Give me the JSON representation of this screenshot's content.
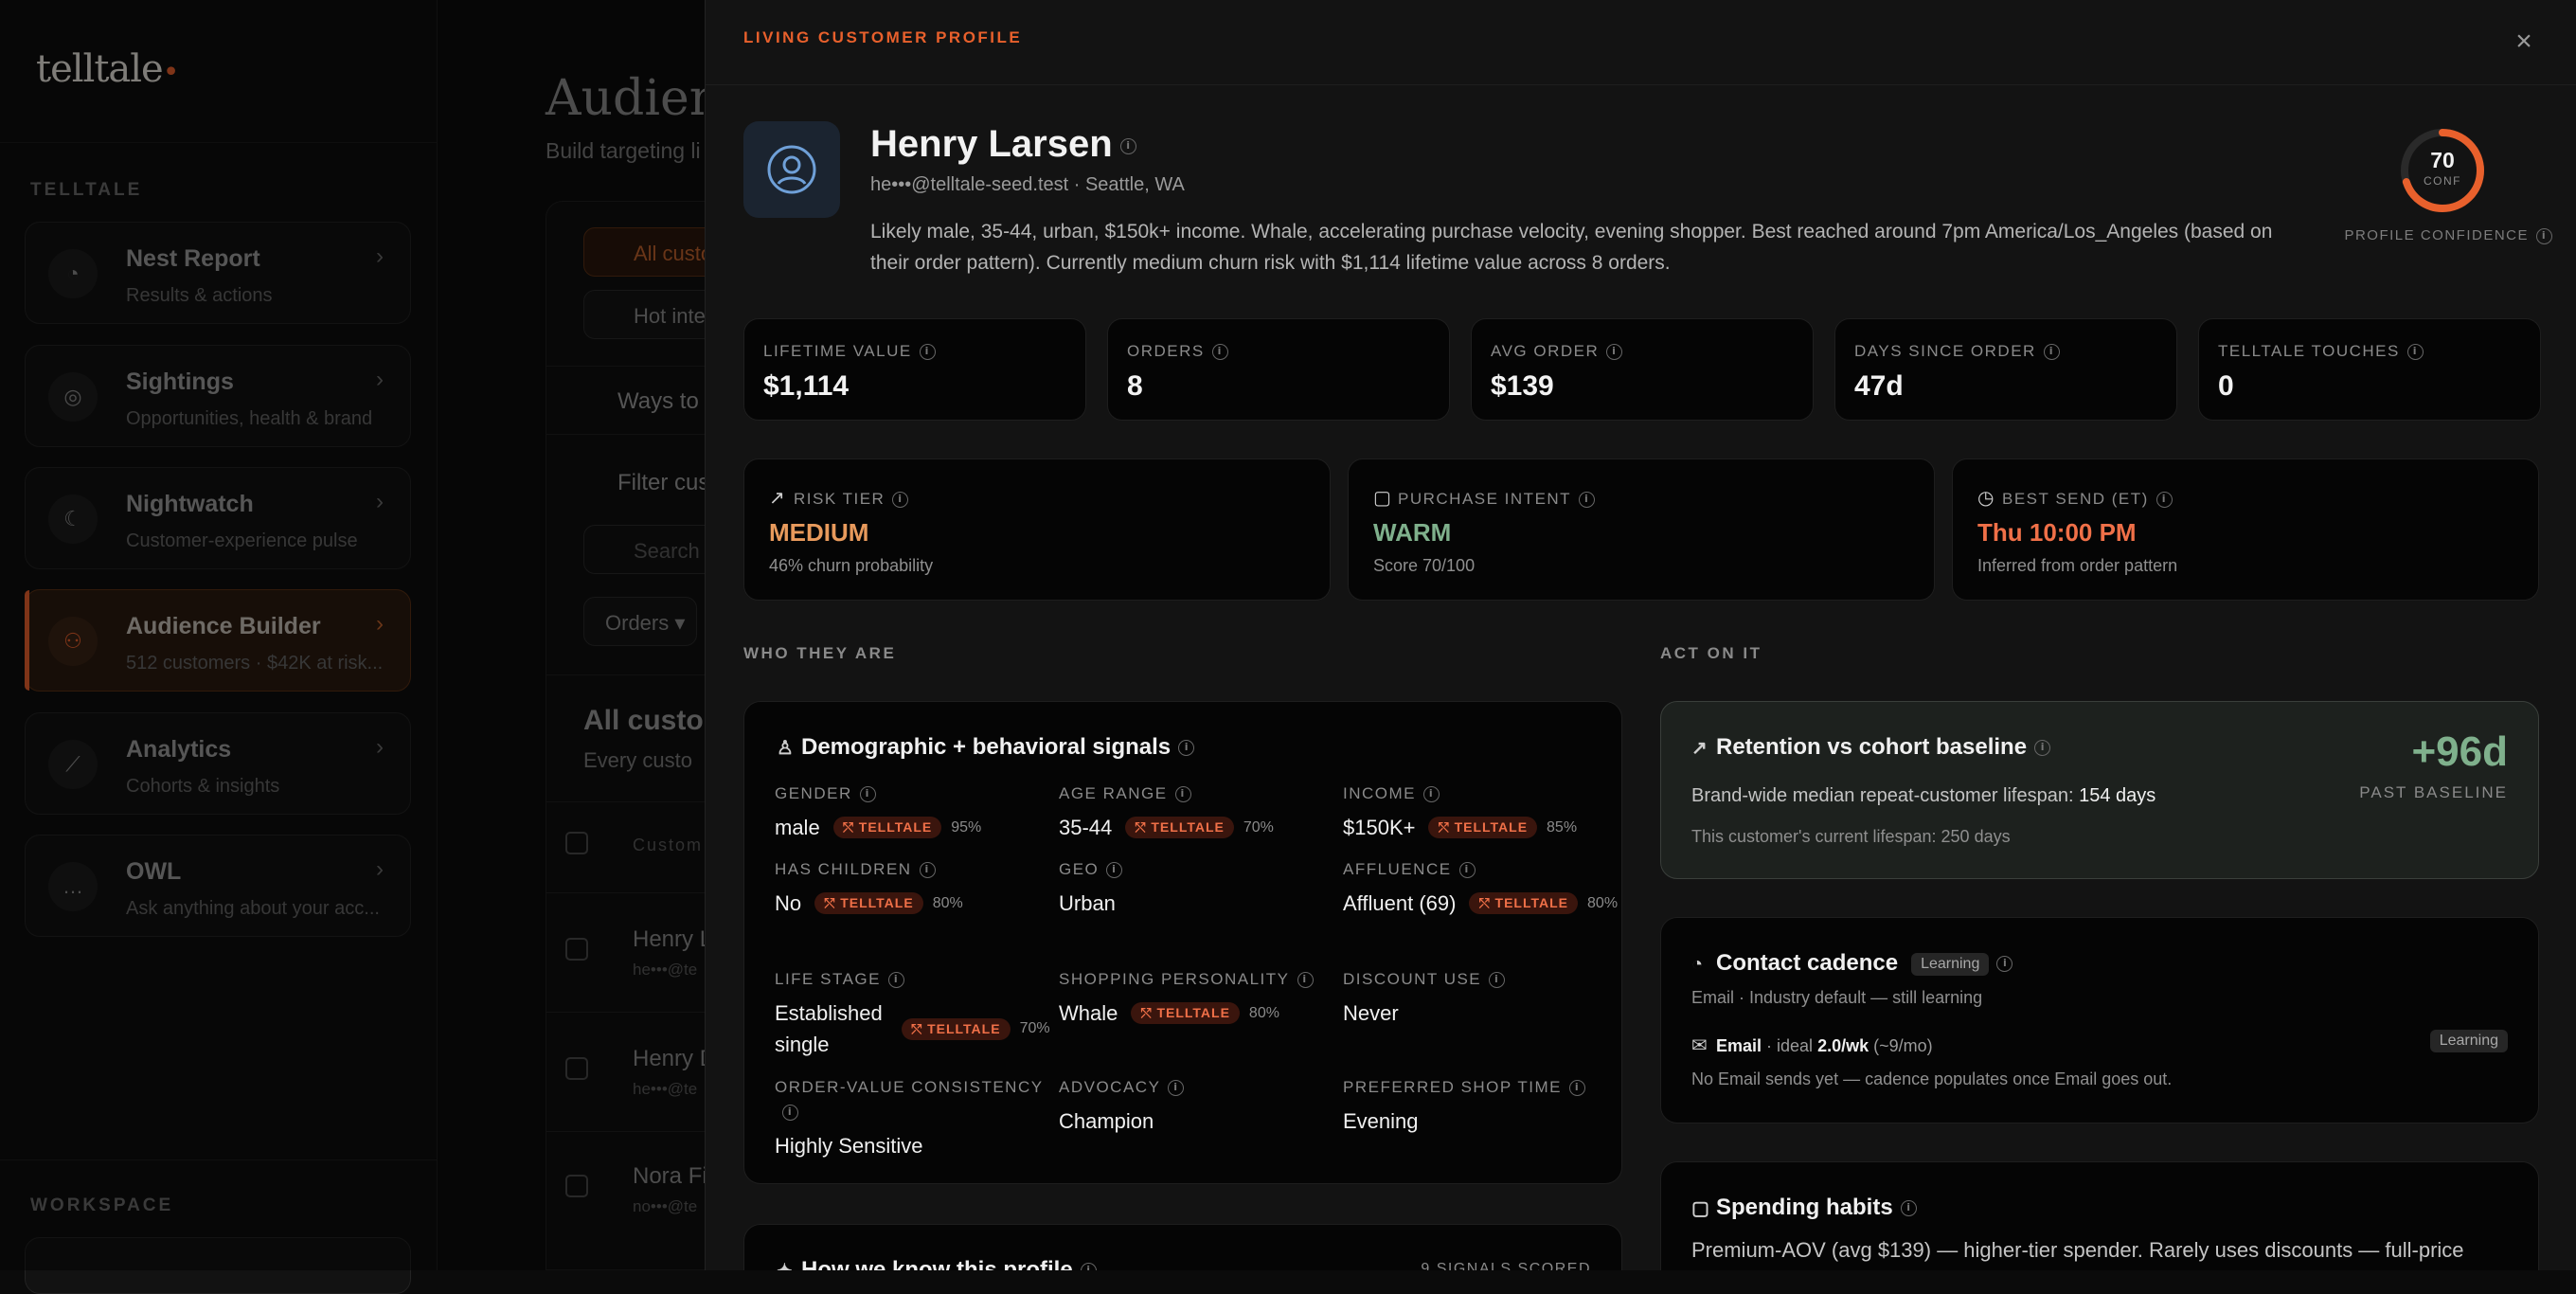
{
  "sidebar": {
    "logo": "telltale",
    "section_label": "TELLTALE",
    "workspace_label": "WORKSPACE",
    "items": [
      {
        "title": "Nest Report",
        "subtitle": "Results & actions"
      },
      {
        "title": "Sightings",
        "subtitle": "Opportunities, health & brand"
      },
      {
        "title": "Nightwatch",
        "subtitle": "Customer-experience pulse"
      },
      {
        "title": "Audience Builder",
        "subtitle": "512 customers · $42K at risk..."
      },
      {
        "title": "Analytics",
        "subtitle": "Cohorts & insights"
      },
      {
        "title": "OWL",
        "subtitle": "Ask anything about your acc..."
      }
    ]
  },
  "background": {
    "title": "Audien",
    "subtitle": "Build targeting li",
    "chip_all": "All custo",
    "chip_hot": "Hot inte",
    "ways": "Ways to",
    "filter": "Filter cus",
    "search_placeholder": "Search",
    "orders_select": "Orders",
    "list_title": "All custon",
    "list_sub": "Every custo",
    "col_header": "Custom",
    "rows": [
      {
        "name": "Henry L",
        "email": "he•••@te"
      },
      {
        "name": "Henry D",
        "email": "he•••@te"
      },
      {
        "name": "Nora Fi",
        "email": "no•••@te"
      }
    ]
  },
  "drawer": {
    "kicker": "LIVING CUSTOMER PROFILE",
    "close_label": "×",
    "profile": {
      "name": "Henry Larsen",
      "email": "he•••@telltale-seed.test · Seattle, WA",
      "summary": "Likely male, 35-44, urban, $150k+ income. Whale, accelerating purchase velocity, evening shopper. Best reached around 7pm America/Los_Angeles (based on their order pattern). Currently medium churn risk with $1,114 lifetime value across 8 orders.",
      "confidence": 70,
      "confidence_unit": "CONF",
      "confidence_label": "PROFILE CONFIDENCE"
    },
    "stats": [
      {
        "label": "LIFETIME VALUE",
        "value": "$1,114"
      },
      {
        "label": "ORDERS",
        "value": "8"
      },
      {
        "label": "AVG ORDER",
        "value": "$139"
      },
      {
        "label": "DAYS SINCE ORDER",
        "value": "47d"
      },
      {
        "label": "TELLTALE TOUCHES",
        "value": "0"
      }
    ],
    "signals": [
      {
        "label": "RISK TIER",
        "value": "MEDIUM",
        "sub": "46% churn probability",
        "color": "#e89a5c"
      },
      {
        "label": "PURCHASE INTENT",
        "value": "WARM",
        "sub": "Score 70/100",
        "color": "#7fb08c"
      },
      {
        "label": "BEST SEND (ET)",
        "value": "Thu 10:00 PM",
        "sub": "Inferred from order pattern",
        "color": "#f07048"
      }
    ],
    "who_label": "WHO THEY ARE",
    "act_label": "ACT ON IT",
    "demo": {
      "title": "Demographic + behavioral signals",
      "badge": "TELLTALE",
      "attributes": [
        {
          "label": "GENDER",
          "value": "male",
          "pct": "95%"
        },
        {
          "label": "AGE RANGE",
          "value": "35-44",
          "pct": "70%"
        },
        {
          "label": "INCOME",
          "value": "$150K+",
          "pct": "85%"
        },
        {
          "label": "HAS CHILDREN",
          "value": "No",
          "pct": "80%"
        },
        {
          "label": "GEO",
          "value": "Urban",
          "pct": ""
        },
        {
          "label": "AFFLUENCE",
          "value": "Affluent (69)",
          "pct": "80%"
        },
        {
          "label": "LIFE STAGE",
          "value": "Established single",
          "pct": "70%"
        },
        {
          "label": "SHOPPING PERSONALITY",
          "value": "Whale",
          "pct": "80%"
        },
        {
          "label": "DISCOUNT USE",
          "value": "Never",
          "pct": ""
        },
        {
          "label": "ORDER-VALUE CONSISTENCY",
          "value": "Highly Sensitive",
          "pct": ""
        },
        {
          "label": "ADVOCACY",
          "value": "Champion",
          "pct": ""
        },
        {
          "label": "PREFERRED SHOP TIME",
          "value": "Evening",
          "pct": ""
        }
      ]
    },
    "know": {
      "title": "How we know this profile",
      "right": "9 SIGNALS SCORED"
    },
    "retention": {
      "title": "Retention vs cohort baseline",
      "line_prefix": "Brand-wide median repeat-customer lifespan: ",
      "line_value": "154 days",
      "sub": "This customer's current lifespan: 250 days",
      "delta": "+96d",
      "delta_label": "PAST BASELINE"
    },
    "cadence": {
      "title": "Contact cadence",
      "tag": "Learning",
      "sub": "Email · Industry default — still learning",
      "channel": "Email",
      "ideal_prefix": " · ideal ",
      "ideal_value": "2.0/wk",
      "ideal_suffix": " (~9/mo)",
      "channel_tag": "Learning",
      "note": "No Email sends yet — cadence populates once Email goes out."
    },
    "spending": {
      "title": "Spending habits",
      "text": "Premium-AOV (avg $139) — higher-tier spender. Rarely uses discounts — full-price"
    }
  }
}
